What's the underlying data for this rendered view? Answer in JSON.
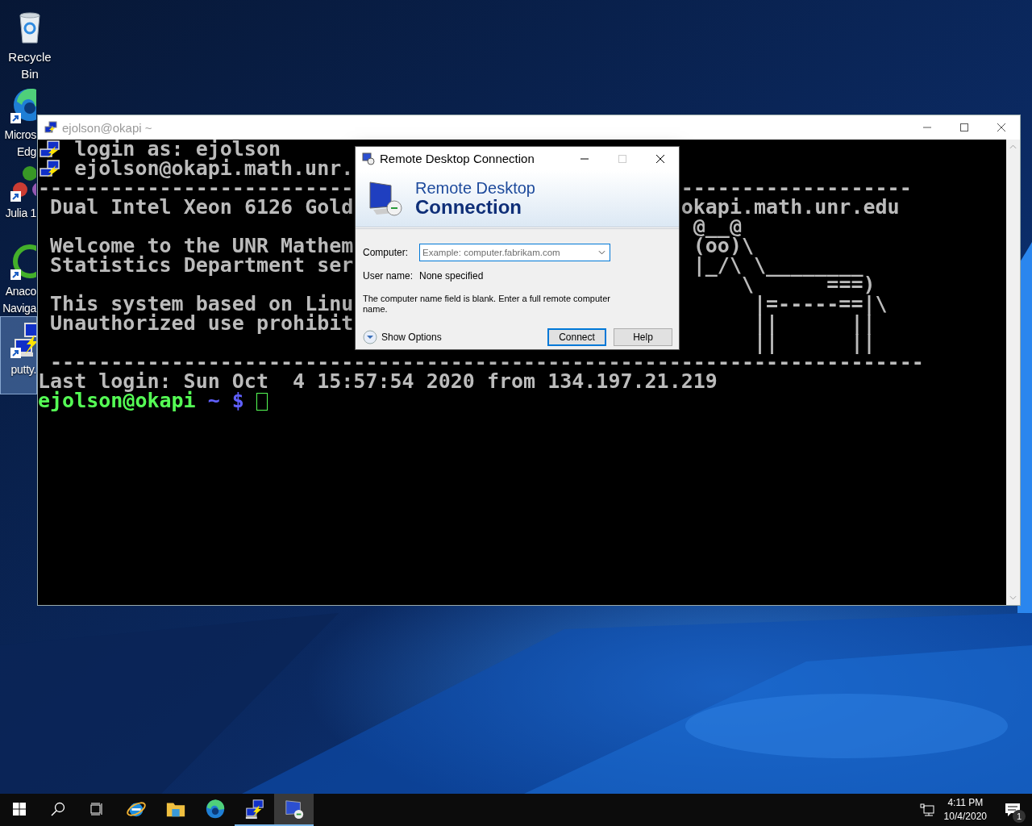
{
  "desktop_icons": [
    {
      "label_lines": [
        "Recycle",
        "Bin"
      ],
      "kind": "system",
      "selected": false
    },
    {
      "label_lines": [
        "Micros",
        "Edg"
      ],
      "kind": "shortcut",
      "selected": false
    },
    {
      "label_lines": [
        "Julia 1"
      ],
      "kind": "shortcut",
      "selected": false
    },
    {
      "label_lines": [
        "Anaco",
        "Naviga"
      ],
      "kind": "shortcut",
      "selected": false
    },
    {
      "label_lines": [
        "putty."
      ],
      "kind": "shortcut",
      "selected": true
    }
  ],
  "terminal_window": {
    "title": "ejolson@okapi ~",
    "active": false,
    "maximize_enabled": true,
    "lines": [
      {
        "kind": "putty",
        "left": "login as: ejolson"
      },
      {
        "kind": "putty",
        "left": "ejolson@okapi.math.unr."
      },
      {
        "kind": "text",
        "left": "--------------------------",
        "right": "-------------------"
      },
      {
        "kind": "text",
        "left": " Dual Intel Xeon 6126 Gold",
        "right": "okapi.math.unr.edu"
      },
      {
        "kind": "text",
        "right": " @__@"
      },
      {
        "kind": "text",
        "left": " Welcome to the UNR Mathem",
        "right": " (oo)\\"
      },
      {
        "kind": "text",
        "left": " Statistics Department ser",
        "right": " |_/\\ \\________"
      },
      {
        "kind": "text",
        "right": "     \\      ===)"
      },
      {
        "kind": "text",
        "left": " This system based on Linu",
        "right": "      |=-----==|\\"
      },
      {
        "kind": "text",
        "left": " Unauthorized use prohibit",
        "right": "      ||      ||"
      },
      {
        "kind": "text",
        "right": "      ||      ||"
      },
      {
        "kind": "text",
        "left": " ------------------------------------------------------------------------"
      },
      {
        "kind": "text",
        "left": "Last login: Sun Oct  4 15:57:54 2020 from 134.197.21.219"
      },
      {
        "kind": "prompt",
        "user": "ejolson@okapi",
        "path": "~",
        "symbol": "$",
        "cursor": true
      }
    ]
  },
  "dialog": {
    "title": "Remote Desktop Connection",
    "active": true,
    "maximize_enabled": false,
    "banner": [
      "Remote Desktop",
      "Connection"
    ],
    "fields": [
      {
        "kind": "combo",
        "label": "Computer:",
        "placeholder": "Example: computer.fabrikam.com",
        "focused": true
      },
      {
        "kind": "static",
        "label": "User name:",
        "value": "None specified"
      }
    ],
    "message": "The computer name field is blank. Enter a full remote computer name.",
    "options_toggle": "Show Options",
    "buttons": [
      {
        "label": "Connect",
        "default": true
      },
      {
        "label": "Help",
        "default": false
      }
    ]
  },
  "taskbar": {
    "apps": [
      {
        "running": false,
        "active": false
      },
      {
        "running": false,
        "active": false
      },
      {
        "running": false,
        "active": false
      },
      {
        "running": true,
        "active": false
      },
      {
        "running": true,
        "active": true
      }
    ],
    "clock": {
      "time": "4:11 PM",
      "date": "10/4/2020"
    },
    "notifications": {
      "count": "1"
    }
  }
}
